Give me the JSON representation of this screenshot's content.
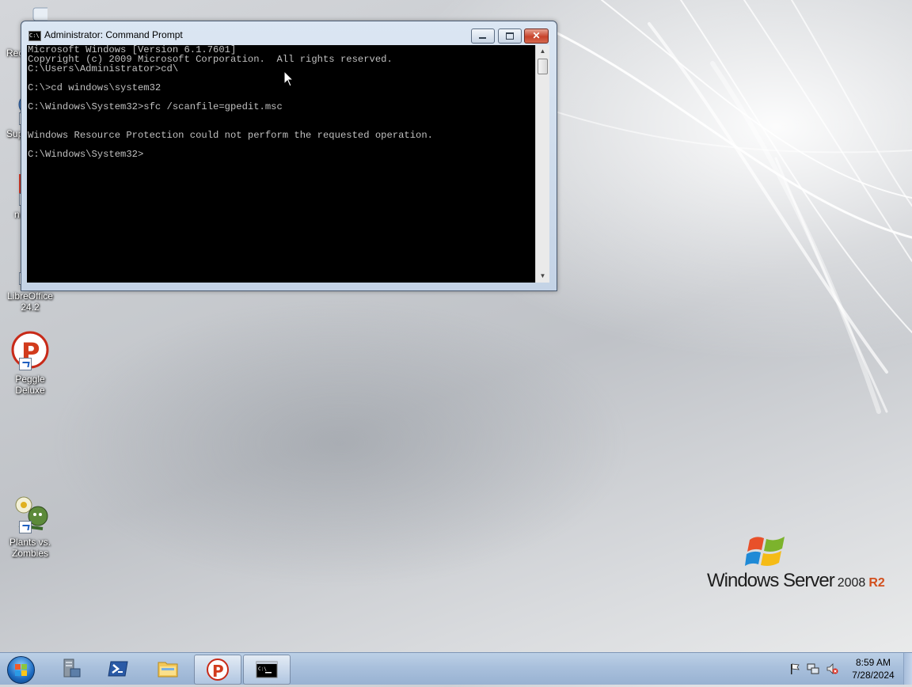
{
  "desktop": {
    "icons": [
      {
        "label_top": "Rec",
        "label_bottom": ""
      },
      {
        "label_top": "Sup",
        "label_bottom": ""
      },
      {
        "label_top": "n",
        "label_bottom": ""
      },
      {
        "label_top": "LibreOffice",
        "label_bottom": "24.2"
      },
      {
        "label_top": "Peggle",
        "label_bottom": "Deluxe"
      },
      {
        "label_top": "Plants vs.",
        "label_bottom": "Zombies"
      }
    ]
  },
  "cmd_window": {
    "title": "Administrator: Command Prompt",
    "icon_glyph": "C:\\",
    "console_text": "Microsoft Windows [Version 6.1.7601]\nCopyright (c) 2009 Microsoft Corporation.  All rights reserved.\nC:\\Users\\Administrator>cd\\\n\nC:\\>cd windows\\system32\n\nC:\\Windows\\System32>sfc /scanfile=gpedit.msc\n\n\nWindows Resource Protection could not perform the requested operation.\n\nC:\\Windows\\System32>",
    "close_glyph": "✕",
    "scroll_up_glyph": "▲",
    "scroll_down_glyph": "▼"
  },
  "branding": {
    "brand": "Windows Server",
    "version": "2008",
    "edition": "R2"
  },
  "taskbar": {
    "buttons": [
      {
        "name": "server-manager",
        "active": false
      },
      {
        "name": "powershell",
        "active": false
      },
      {
        "name": "windows-explorer",
        "active": false
      },
      {
        "name": "peggle-deluxe",
        "active": true
      },
      {
        "name": "command-prompt",
        "active": true
      }
    ],
    "tray_icons": [
      "flag-icon",
      "network-icon",
      "volume-muted-icon"
    ],
    "clock": {
      "time": "8:59 AM",
      "date": "7/28/2024"
    }
  },
  "colors": {
    "console_bg": "#000000",
    "console_fg": "#c0c0c0",
    "close_red": "#c7422b",
    "r2_orange": "#d2501e"
  }
}
